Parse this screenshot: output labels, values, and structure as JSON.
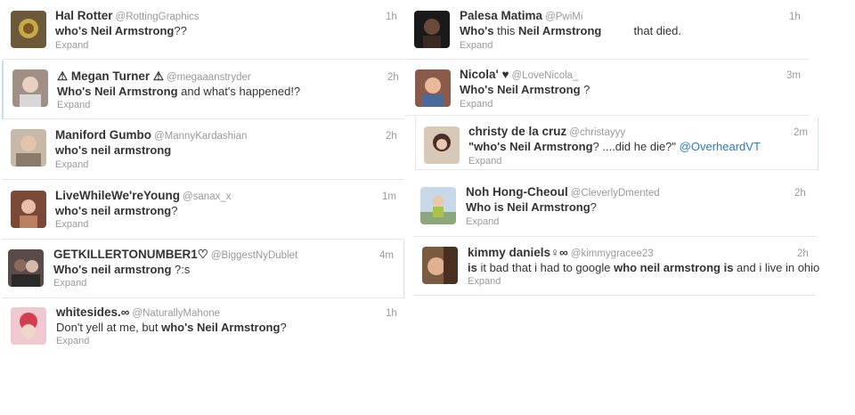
{
  "left": [
    {
      "name": "Hal Rotter",
      "handle": "@RottingGraphics",
      "time": "1h",
      "text": [
        {
          "t": "who's Neil Armstrong",
          "b": true
        },
        {
          "t": "??"
        }
      ],
      "expand": "Expand",
      "avatar": "#6b5a3a"
    },
    {
      "name": "⚠ Megan Turner ⚠",
      "handle": "@megaaanstryder",
      "time": "2h",
      "text": [
        {
          "t": "Who's Neil Armstrong",
          "b": true
        },
        {
          "t": " and what's happened!?"
        }
      ],
      "expand": "Expand",
      "avatar": "#a08f85"
    },
    {
      "name": "Maniford Gumbo",
      "handle": "@MannyKardashian",
      "time": "2h",
      "text": [
        {
          "t": "who's neil armstrong",
          "b": true
        }
      ],
      "expand": "Expand",
      "avatar": "#b9a28c"
    },
    {
      "name": "LiveWhileWe'reYoung",
      "handle": "@sanax_x",
      "time": "1m",
      "text": [
        {
          "t": "who's neil armstrong",
          "b": true
        },
        {
          "t": "?"
        }
      ],
      "expand": "Expand",
      "avatar": "#7a4a36"
    },
    {
      "name": "GETKILLERTONUMBER1♡",
      "handle": "@BiggestNyDublet",
      "time": "4m",
      "text": [
        {
          "t": "Who's neil armstrong",
          "b": true
        },
        {
          "t": " ?:s"
        }
      ],
      "expand": "Expand",
      "avatar": "#5a4a48"
    },
    {
      "name": "whitesides.∞",
      "handle": "@NaturallyMahone",
      "time": "1h",
      "text": [
        {
          "t": "Don't yell at me, but "
        },
        {
          "t": "who's Neil Armstrong",
          "b": true
        },
        {
          "t": "?"
        }
      ],
      "expand": "Expand",
      "avatar": "#c98a8a"
    }
  ],
  "right": [
    {
      "name": "Palesa Matima",
      "handle": "@PwiMi",
      "time": "1h",
      "text": [
        {
          "t": "Who's",
          "b": true
        },
        {
          "t": " this "
        },
        {
          "t": "Neil Armstrong",
          "b": true
        },
        {
          "t": "          "
        },
        {
          "t": "that died."
        }
      ],
      "expand": "Expand",
      "avatar": "#3a2a22"
    },
    {
      "name": "Nicola' ♥",
      "handle": "@LoveNicola_",
      "time": "3m",
      "text": [
        {
          "t": "Who's Neil Armstrong",
          "b": true
        },
        {
          "t": " ?"
        }
      ],
      "expand": "Expand",
      "avatar": "#8a5a4a"
    },
    {
      "name": "christy de la cruz",
      "handle": "@christayyy",
      "time": "2m",
      "text": [
        {
          "t": "\"who's Neil Armstrong",
          "b": true
        },
        {
          "t": "? ....did he die?\" "
        },
        {
          "t": "@OverheardVT",
          "link": true
        }
      ],
      "expand": "Expand",
      "avatar": "#4a3028"
    },
    {
      "name": "Noh Hong-Cheoul",
      "handle": "@CleverlyDmented",
      "time": "2h",
      "text": [
        {
          "t": "Who is Neil Armstrong",
          "b": true
        },
        {
          "t": "?"
        }
      ],
      "expand": "Expand",
      "avatar": "#a8c48a"
    },
    {
      "name": "kimmy daniels♀∞",
      "handle": "@kimmygracee23",
      "time": "2h",
      "text": [
        {
          "t": "is",
          "b": true
        },
        {
          "t": " it bad that i had to google "
        },
        {
          "t": "who neil armstrong is",
          "b": true
        },
        {
          "t": " and i live in ohio"
        }
      ],
      "expand": "Expand",
      "avatar": "#7a5a40"
    }
  ]
}
